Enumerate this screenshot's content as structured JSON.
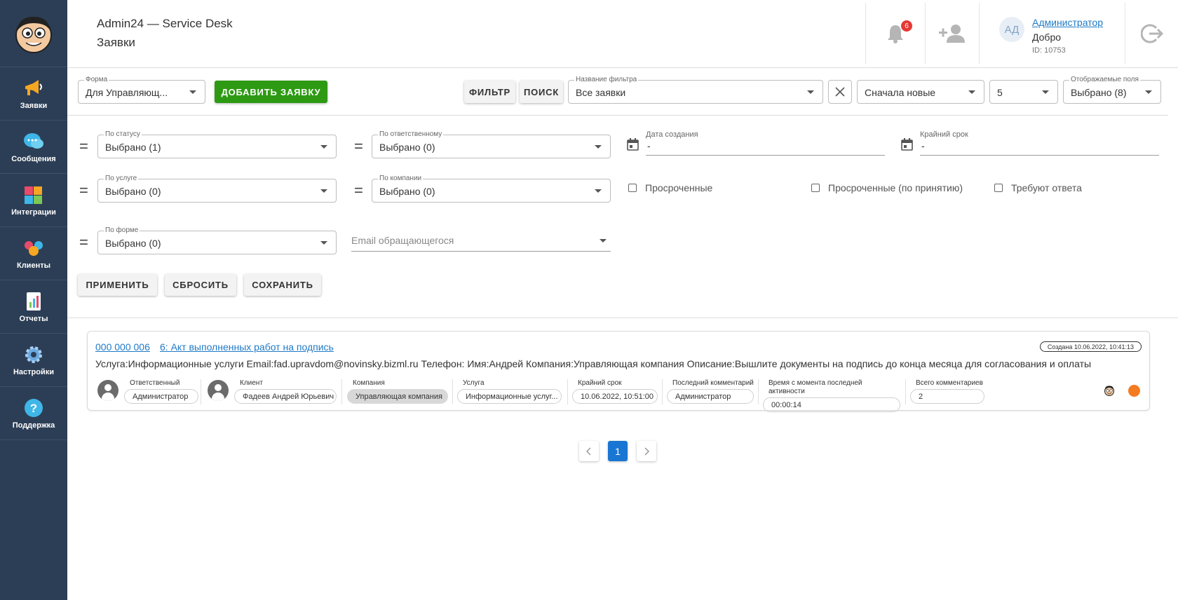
{
  "sidebar": {
    "items": [
      {
        "label": "Заявки",
        "icon": "megaphone-icon"
      },
      {
        "label": "Сообщения",
        "icon": "chat-bubbles-icon"
      },
      {
        "label": "Интеграции",
        "icon": "puzzle-icon"
      },
      {
        "label": "Клиенты",
        "icon": "users-icon"
      },
      {
        "label": "Отчеты",
        "icon": "report-icon"
      },
      {
        "label": "Настройки",
        "icon": "gear-icon"
      },
      {
        "label": "Поддержка",
        "icon": "help-icon"
      }
    ]
  },
  "header": {
    "app_title": "Admin24 — Service Desk",
    "page_title": "Заявки",
    "notifications_count": "6",
    "user": {
      "initials": "АД",
      "name": "Администратор",
      "greeting": "Добро",
      "id": "ID: 10753"
    }
  },
  "toolbar": {
    "form": {
      "label": "Форма",
      "value": "Для Управляющ..."
    },
    "add_button": "ДОБАВИТЬ ЗАЯВКУ",
    "filter_button": "ФИЛЬТР",
    "search_button": "ПОИСК",
    "filter_name": {
      "label": "Название фильтра",
      "value": "Все заявки"
    },
    "sort": {
      "value": "Сначала новые"
    },
    "per_page": {
      "value": "5"
    },
    "fields": {
      "label": "Отображаемые поля",
      "value": "Выбрано (8)"
    }
  },
  "filters": {
    "status": {
      "label": "По статусу",
      "value": "Выбрано (1)"
    },
    "responsible": {
      "label": "По ответственному",
      "value": "Выбрано (0)"
    },
    "created": {
      "label": "Дата создания",
      "value": "-"
    },
    "deadline": {
      "label": "Крайний срок",
      "value": "-"
    },
    "service": {
      "label": "По услуге",
      "value": "Выбрано (0)"
    },
    "company": {
      "label": "По компании",
      "value": "Выбрано (0)"
    },
    "overdue": "Просроченные",
    "overdue_accept": "Просроченные (по принятию)",
    "need_answer": "Требуют ответа",
    "form": {
      "label": "По форме",
      "value": "Выбрано (0)"
    },
    "email_placeholder": "Email обращающегося",
    "apply": "ПРИМЕНИТЬ",
    "reset": "СБРОСИТЬ",
    "save": "СОХРАНИТЬ"
  },
  "ticket": {
    "number": "000 000 006",
    "title": "6: Акт выполненных работ на подпись",
    "created": "Создана 10.06.2022, 10:41:13",
    "description": "Услуга:Информационные услуги Email:fad.upravdom@novinsky.bizml.ru Телефон: Имя:Андрей Компания:Управляющая компания Описание:Вышлите документы на подпись до конца месяца для согласования и оплаты",
    "meta": {
      "responsible": {
        "label": "Ответственный",
        "value": "Администратор"
      },
      "client": {
        "label": "Клиент",
        "value": "Фадеев Андрей Юрьевич"
      },
      "company": {
        "label": "Компания",
        "value": "Управляющая компания"
      },
      "service": {
        "label": "Услуга",
        "value": "Информационные услуг..."
      },
      "deadline": {
        "label": "Крайний срок",
        "value": "10.06.2022, 10:51:00"
      },
      "last_comment": {
        "label": "Последний комментарий",
        "value": "Администратор"
      },
      "since_activity": {
        "label": "Время с момента последней активности",
        "value": "00:00:14"
      },
      "total_comments": {
        "label": "Всего комментариев",
        "value": "2"
      }
    },
    "status_color": "#f47b20"
  },
  "pagination": {
    "current": "1"
  }
}
